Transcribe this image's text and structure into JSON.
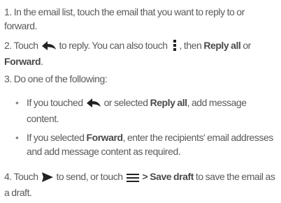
{
  "steps": {
    "s1": {
      "num": "1.",
      "text": "In the email list, touch the email that you want to reply to or forward."
    },
    "s2": {
      "num": "2.",
      "a": "Touch",
      "b": "to reply. You can also touch",
      "c": ", then",
      "reply_all": "Reply all",
      "or": "or",
      "forward": "Forward",
      "end": "."
    },
    "s3": {
      "num": "3.",
      "text": "Do one of the following:"
    },
    "b1": {
      "a": "If you touched",
      "b": "or selected",
      "reply_all": "Reply all",
      "c": ", add message content."
    },
    "b2": {
      "a": "If you selected",
      "forward": "Forward",
      "b": ", enter the recipients' email addresses and add message content as required."
    },
    "s4": {
      "num": "4.",
      "a": "Touch",
      "b": "to send, or touch",
      "c": ">",
      "save_draft": "Save draft",
      "d": "to save the email as a draft."
    }
  },
  "bullet_glyph": "•",
  "icons": [
    "reply-icon",
    "menu-dots-icon",
    "send-icon",
    "menu-lines-icon"
  ],
  "colors": {
    "text": "#5a5a5a",
    "bold": "#4a4a4a",
    "icon": "#222222"
  }
}
